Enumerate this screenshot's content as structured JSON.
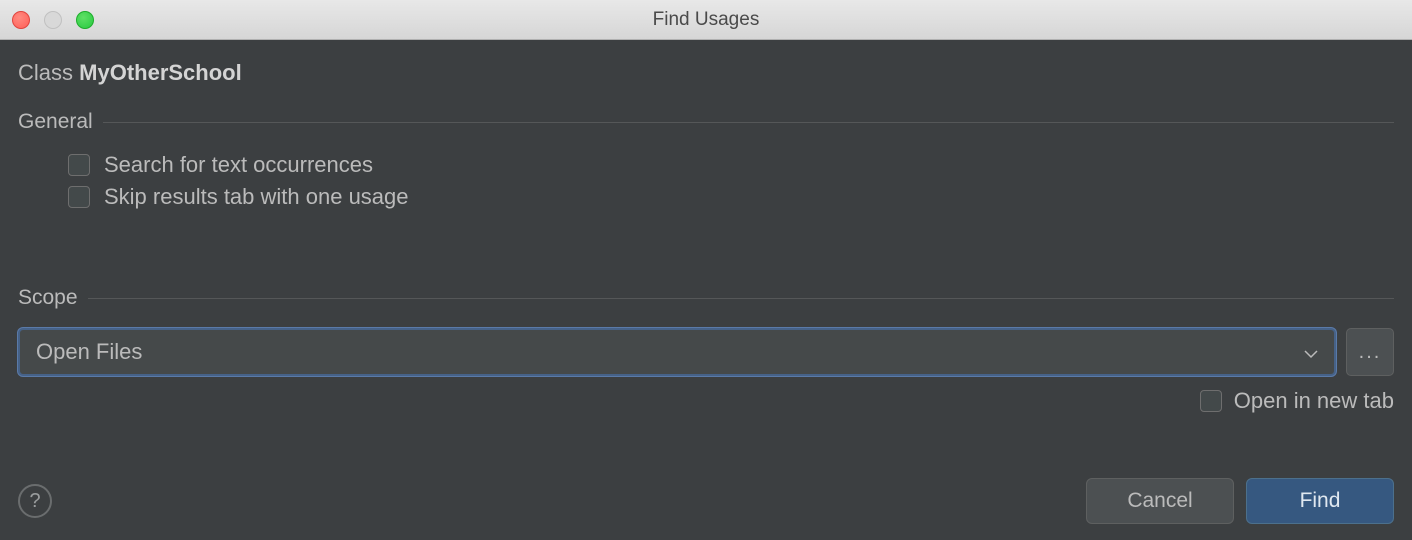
{
  "titlebar": {
    "title": "Find Usages"
  },
  "header": {
    "prefix": "Class",
    "name": "MyOtherSchool"
  },
  "sections": {
    "general": {
      "label": "General",
      "search_text_occurrences": "Search for text occurrences",
      "skip_results_tab": "Skip results tab with one usage"
    },
    "scope": {
      "label": "Scope",
      "selected": "Open Files",
      "ellipsis": "..."
    }
  },
  "open_new_tab": "Open in new tab",
  "footer": {
    "help": "?",
    "cancel": "Cancel",
    "find": "Find"
  }
}
